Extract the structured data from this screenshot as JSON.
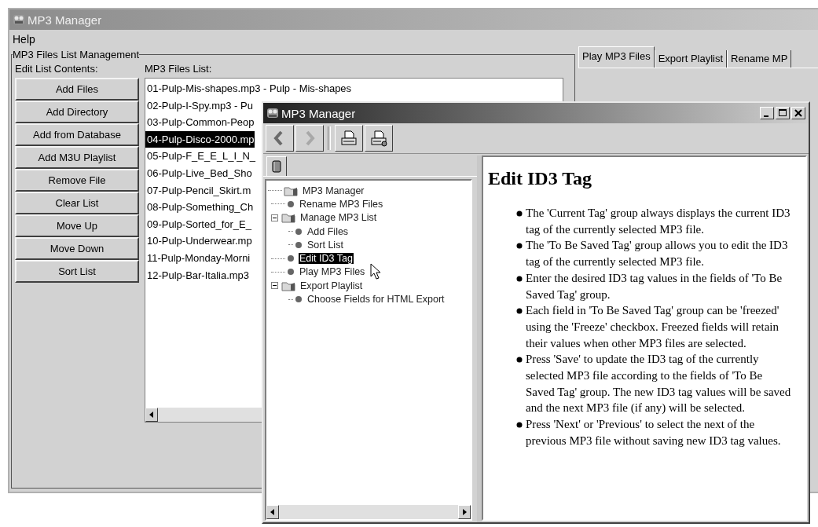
{
  "main_window": {
    "title": "MP3 Manager",
    "menu": [
      "Help"
    ],
    "group": {
      "title": "MP3 Files List Management",
      "buttons_label": "Edit List Contents:",
      "list_label": "MP3 Files List:",
      "buttons": [
        "Add Files",
        "Add Directory",
        "Add from Database",
        "Add M3U Playlist",
        "Remove File",
        "Clear List",
        "Move Up",
        "Move Down",
        "Sort List"
      ],
      "files": [
        {
          "label": "01-Pulp-Mis-shapes.mp3 - Pulp - Mis-shapes",
          "selected": false
        },
        {
          "label": "02-Pulp-I-Spy.mp3 - Pu",
          "selected": false
        },
        {
          "label": "03-Pulp-Common-Peop",
          "selected": false
        },
        {
          "label": "04-Pulp-Disco-2000.mp",
          "selected": true
        },
        {
          "label": "05-Pulp-F_E_E_L_I_N_",
          "selected": false
        },
        {
          "label": "06-Pulp-Live_Bed_Sho",
          "selected": false
        },
        {
          "label": "07-Pulp-Pencil_Skirt.m",
          "selected": false
        },
        {
          "label": "08-Pulp-Something_Ch",
          "selected": false
        },
        {
          "label": "09-Pulp-Sorted_for_E_",
          "selected": false
        },
        {
          "label": "10-Pulp-Underwear.mp",
          "selected": false
        },
        {
          "label": "11-Pulp-Monday-Morni",
          "selected": false
        },
        {
          "label": "12-Pulp-Bar-Italia.mp3",
          "selected": false
        }
      ]
    },
    "tabs": [
      {
        "label": "Play MP3 Files",
        "selected": true
      },
      {
        "label": "Export Playlist",
        "selected": false
      },
      {
        "label": "Rename MP",
        "selected": false
      }
    ]
  },
  "help_window": {
    "title": "MP3 Manager",
    "toolbar": [
      {
        "kind": "back"
      },
      {
        "kind": "forward"
      },
      {
        "kind": "print"
      },
      {
        "kind": "print-setup"
      }
    ],
    "tree": [
      {
        "label": "MP3 Manager",
        "kind": "folder",
        "selected": false,
        "children": [
          {
            "label": "Rename MP3 Files",
            "kind": "page",
            "selected": false
          },
          {
            "label": "Manage MP3 List",
            "kind": "folder",
            "expanded": true,
            "selected": false,
            "children": [
              {
                "label": "Add Files",
                "kind": "page",
                "selected": false
              },
              {
                "label": "Sort List",
                "kind": "page",
                "selected": false
              }
            ]
          },
          {
            "label": "Edit ID3 Tag",
            "kind": "page",
            "selected": true
          },
          {
            "label": "Play MP3 Files",
            "kind": "page",
            "selected": false
          },
          {
            "label": "Export Playlist",
            "kind": "folder",
            "expanded": true,
            "selected": false,
            "children": [
              {
                "label": "Choose Fields for HTML Export",
                "kind": "page",
                "selected": false
              }
            ]
          }
        ]
      }
    ],
    "page": {
      "heading": "Edit ID3 Tag",
      "bullets": [
        "The 'Current Tag' group always displays the current ID3 tag of the currently selected MP3 file.",
        "The 'To Be Saved Tag' group allows you to edit the ID3 tag of the currently selected MP3 file.",
        "Enter the desired ID3 tag values in the fields of 'To Be Saved Tag' group.",
        "Each field in 'To Be Saved Tag' group can be 'freezed' using the 'Freeze' checkbox. Freezed fields will retain their values when other MP3 files are selected.",
        "Press 'Save' to update the ID3 tag of the currently selected MP3 file according to the fields of 'To Be Saved Tag' group.  The new ID3 tag values will be saved and the next MP3 file (if any) will be selected.",
        "Press 'Next' or 'Previous' to select the next of the previous MP3 file without saving new ID3 tag values."
      ]
    }
  }
}
